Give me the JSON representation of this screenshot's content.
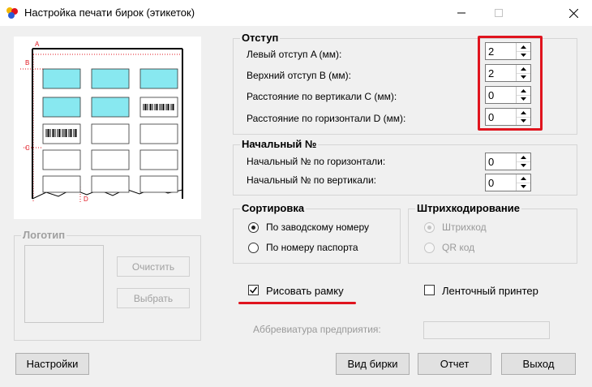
{
  "window": {
    "title": "Настройка печати бирок (этикеток)",
    "minimize_icon": "minimize-icon",
    "maximize_icon": "maximize-icon",
    "close_icon": "close-icon"
  },
  "preview": {
    "marker_a": "A",
    "marker_b": "B",
    "marker_c": "C",
    "marker_d": "D",
    "tile_color": "#88e8f0"
  },
  "indent": {
    "title": "Отступ",
    "left_label": "Левый отступ A (мм):",
    "left_value": "2",
    "top_label": "Верхний отступ B (мм):",
    "top_value": "2",
    "vertical_label": "Расстояние по вертикали C (мм):",
    "vertical_value": "0",
    "horizontal_label": "Расстояние по горизонтали D (мм):",
    "horizontal_value": "0"
  },
  "start_number": {
    "title": "Начальный №",
    "horizontal_label": "Начальный № по горизонтали:",
    "horizontal_value": "0",
    "vertical_label": "Начальный № по вертикали:",
    "vertical_value": "0"
  },
  "sorting": {
    "title": "Сортировка",
    "option1": "По заводскому номеру",
    "option2": "По номеру паспорта",
    "selected": 1
  },
  "barcode": {
    "title": "Штрихкодирование",
    "option1": "Штрихкод",
    "option2": "QR код",
    "enabled": false
  },
  "logo": {
    "title": "Логотип",
    "clear_button": "Очистить",
    "choose_button": "Выбрать",
    "enabled": false
  },
  "options": {
    "draw_frame_label": "Рисовать рамку",
    "draw_frame_checked": true,
    "tape_printer_label": "Ленточный принтер",
    "tape_printer_checked": false
  },
  "abbreviation": {
    "label": "Аббревиатура предприятия:",
    "value": ""
  },
  "buttons": {
    "settings": "Настройки",
    "preview_tag": "Вид бирки",
    "report": "Отчет",
    "exit": "Выход"
  },
  "colors": {
    "annotation_red": "#e0141e",
    "background": "#f0f0f0"
  }
}
